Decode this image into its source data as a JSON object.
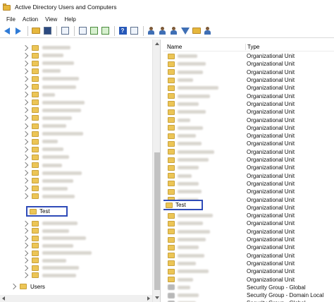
{
  "window": {
    "title": "Active Directory Users and Computers"
  },
  "menu": [
    "File",
    "Action",
    "View",
    "Help"
  ],
  "toolbar": {
    "icons": [
      "back-arrow-icon",
      "forward-arrow-icon",
      "folder-icon",
      "details-view-icon",
      "properties-icon",
      "export-icon",
      "refresh-icon",
      "copy-icon",
      "help-icon",
      "show-pane-icon",
      "users-icon",
      "add-user-icon",
      "add-group-icon",
      "filter-icon",
      "find-icon",
      "delegate-icon"
    ]
  },
  "tree": {
    "selected_label": "Test",
    "users_label": "Users"
  },
  "list": {
    "headers": {
      "name": "Name",
      "type": "Type"
    },
    "selected_label": "Test",
    "rows": [
      {
        "kind": "ou",
        "type": "Organizational Unit"
      },
      {
        "kind": "ou",
        "type": "Organizational Unit"
      },
      {
        "kind": "ou",
        "type": "Organizational Unit"
      },
      {
        "kind": "ou",
        "type": "Organizational Unit"
      },
      {
        "kind": "ou",
        "type": "Organizational Unit"
      },
      {
        "kind": "ou",
        "type": "Organizational Unit"
      },
      {
        "kind": "ou",
        "type": "Organizational Unit"
      },
      {
        "kind": "ou",
        "type": "Organizational Unit"
      },
      {
        "kind": "ou",
        "type": "Organizational Unit"
      },
      {
        "kind": "ou",
        "type": "Organizational Unit"
      },
      {
        "kind": "ou",
        "type": "Organizational Unit"
      },
      {
        "kind": "ou",
        "type": "Organizational Unit"
      },
      {
        "kind": "ou",
        "type": "Organizational Unit"
      },
      {
        "kind": "ou",
        "type": "Organizational Unit"
      },
      {
        "kind": "ou",
        "type": "Organizational Unit"
      },
      {
        "kind": "ou",
        "type": "Organizational Unit"
      },
      {
        "kind": "ou",
        "type": "Organizational Unit"
      },
      {
        "kind": "ou",
        "type": "Organizational Unit"
      },
      {
        "kind": "ou",
        "type": "Organizational Unit"
      },
      {
        "kind": "ou",
        "type": "Organizational Unit"
      },
      {
        "kind": "ou",
        "type": "Organizational Unit"
      },
      {
        "kind": "ou",
        "type": "Organizational Unit"
      },
      {
        "kind": "ou",
        "type": "Organizational Unit"
      },
      {
        "kind": "ou",
        "type": "Organizational Unit"
      },
      {
        "kind": "ou",
        "type": "Organizational Unit"
      },
      {
        "kind": "ou",
        "type": "Organizational Unit"
      },
      {
        "kind": "ou",
        "type": "Organizational Unit"
      },
      {
        "kind": "ou",
        "type": "Organizational Unit"
      },
      {
        "kind": "ou",
        "type": "Organizational Unit"
      },
      {
        "kind": "group",
        "type": "Security Group - Global"
      },
      {
        "kind": "group",
        "type": "Security Group - Domain Local"
      },
      {
        "kind": "group",
        "type": "Security Group - Global"
      }
    ]
  },
  "colors": {
    "selection_border": "#2f4bb8",
    "folder": "#ecc556"
  }
}
